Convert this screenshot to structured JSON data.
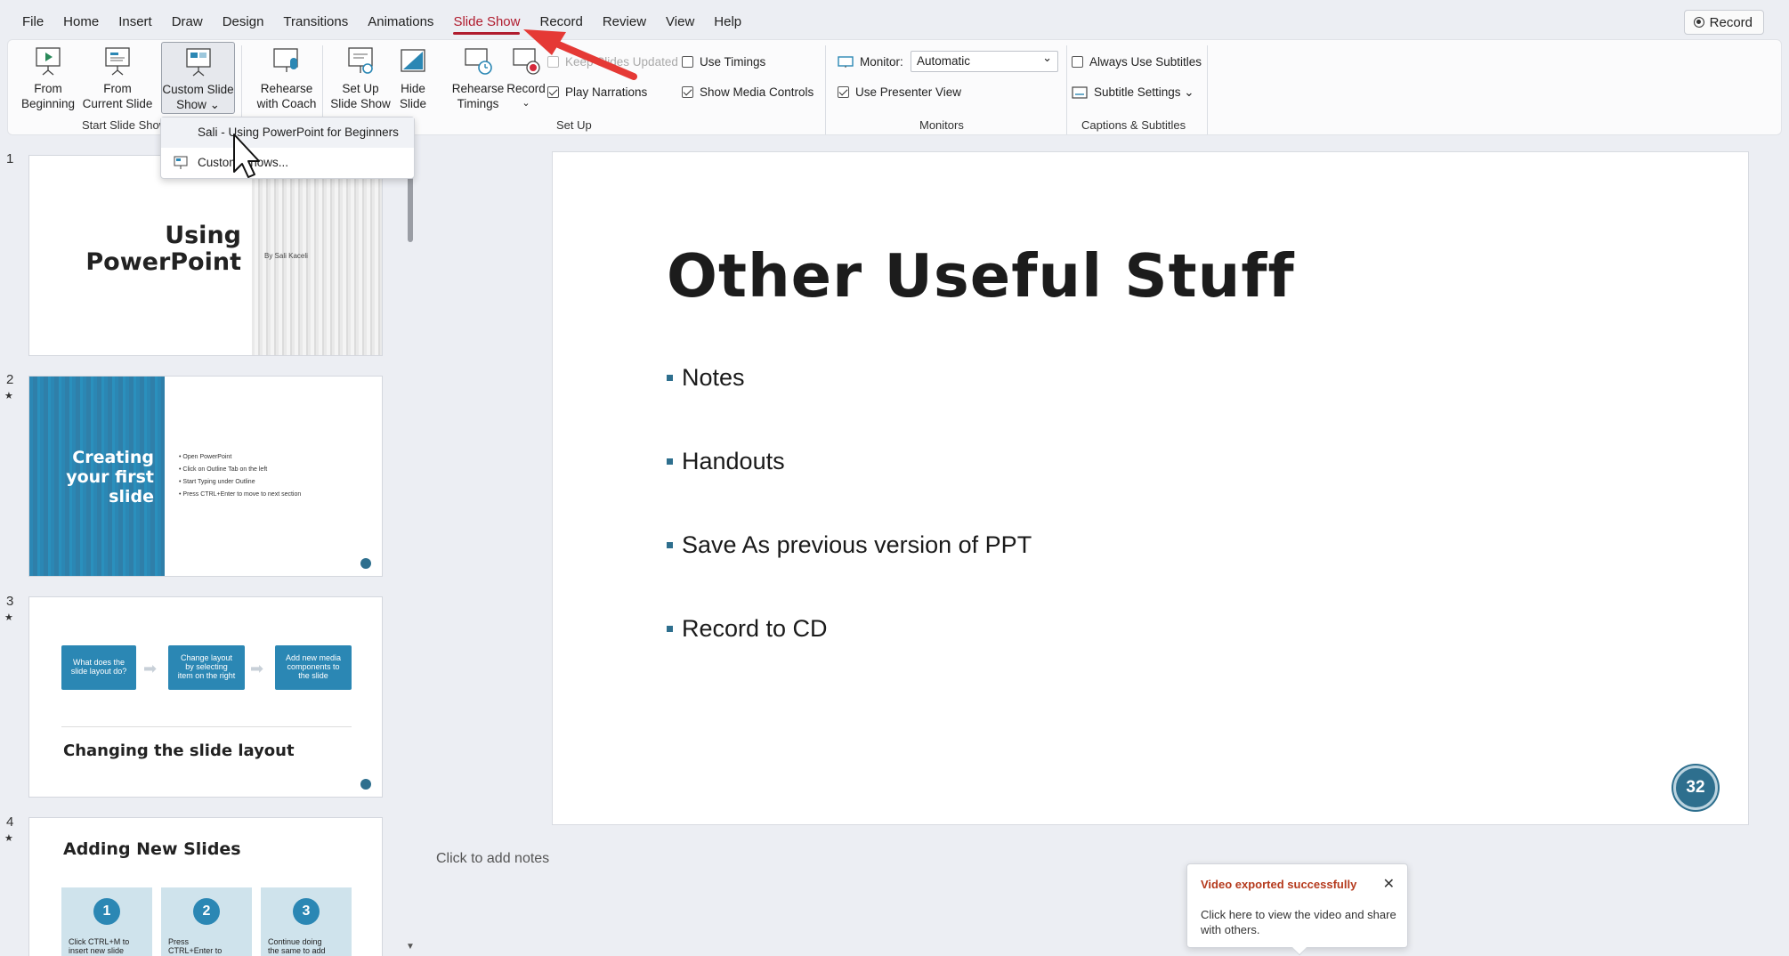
{
  "menu": {
    "tabs": [
      "File",
      "Home",
      "Insert",
      "Draw",
      "Design",
      "Transitions",
      "Animations",
      "Slide Show",
      "Record",
      "Review",
      "View",
      "Help"
    ],
    "active_tab": "Slide Show",
    "record_button": "Record"
  },
  "ribbon": {
    "start": {
      "from_beginning": [
        "From",
        "Beginning"
      ],
      "from_current": [
        "From",
        "Current Slide"
      ],
      "custom_show": [
        "Custom Slide",
        "Show ⌄"
      ],
      "group_label": "Start Slide Show"
    },
    "rehearse_coach": [
      "Rehearse",
      "with Coach"
    ],
    "setup": {
      "setup_show": [
        "Set Up",
        "Slide Show"
      ],
      "hide_slide": [
        "Hide",
        "Slide"
      ],
      "rehearse_timings": [
        "Rehearse",
        "Timings"
      ],
      "record": "Record",
      "keep_updated": "Keep Slides Updated",
      "play_narrations": "Play Narrations",
      "use_timings": "Use Timings",
      "show_media_controls": "Show Media Controls",
      "group_label": "Set Up"
    },
    "monitors": {
      "monitor_label": "Monitor:",
      "monitor_value": "Automatic",
      "presenter_view": "Use Presenter View",
      "group_label": "Monitors"
    },
    "captions": {
      "always_subtitles": "Always Use Subtitles",
      "subtitle_settings": "Subtitle Settings ⌄",
      "group_label": "Captions & Subtitles"
    }
  },
  "dropdown": {
    "items": [
      "Sali - Using PowerPoint for Beginners",
      "Custom Shows..."
    ]
  },
  "thumbnails": {
    "numbers": [
      "1",
      "2",
      "3",
      "4"
    ],
    "s1": {
      "title_line1": "Using",
      "title_line2": "PowerPoint",
      "author": "By Sali Kaceli"
    },
    "s2": {
      "title": [
        "Creating",
        "your first",
        "slide"
      ],
      "bullets": [
        "• Open PowerPoint",
        "• Click on Outline Tab on the left",
        "• Start Typing under Outline",
        "• Press CTRL+Enter to move to next section"
      ]
    },
    "s3": {
      "boxes": [
        [
          "What does the",
          "slide layout do?"
        ],
        [
          "Change layout",
          "by selecting",
          "item on the right"
        ],
        [
          "Add new media",
          "components to",
          "the slide"
        ]
      ],
      "title": "Changing the slide layout"
    },
    "s4": {
      "title": "Adding New Slides",
      "steps": [
        "1",
        "2",
        "3"
      ],
      "step_text": [
        [
          "Click CTRL+M to",
          "insert new slide"
        ],
        [
          "Press",
          "CTRL+Enter to"
        ],
        [
          "Continue doing",
          "the same to add"
        ]
      ]
    }
  },
  "slide": {
    "title": "Other Useful Stuff",
    "bullets": [
      "Notes",
      "Handouts",
      "Save As previous version of PPT",
      "Record to CD"
    ],
    "page_number": "32"
  },
  "notes_placeholder": "Click to add notes",
  "toast": {
    "title": "Video exported successfully",
    "body": "Click here to view the video and share with others."
  },
  "colors": {
    "accent": "#b01c2e",
    "slide_teal": "#2e6f8e",
    "thumb_blue": "#2b87b4"
  }
}
